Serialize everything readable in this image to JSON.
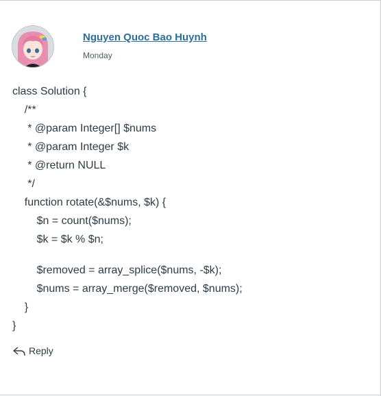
{
  "post": {
    "author": "Nguyen Quoc Bao Huynh",
    "date": "Monday",
    "code_lines": [
      "class Solution {",
      "    /**",
      "     * @param Integer[] $nums",
      "     * @param Integer $k",
      "     * @return NULL",
      "     */",
      "    function rotate(&$nums, $k) {",
      "        $n = count($nums);",
      "        $k = $k % $n;",
      "",
      "        $removed = array_splice($nums, -$k);",
      "        $nums = array_merge($removed, $nums);",
      "    }",
      "}"
    ]
  },
  "actions": {
    "reply_label": "Reply"
  },
  "colors": {
    "link": "#2b6e9c",
    "text": "#2d3b45",
    "muted": "#4c5a64",
    "rule": "#c7cdd1"
  },
  "icons": {
    "avatar": "anime-avatar",
    "reply": "reply-arrow-icon"
  }
}
